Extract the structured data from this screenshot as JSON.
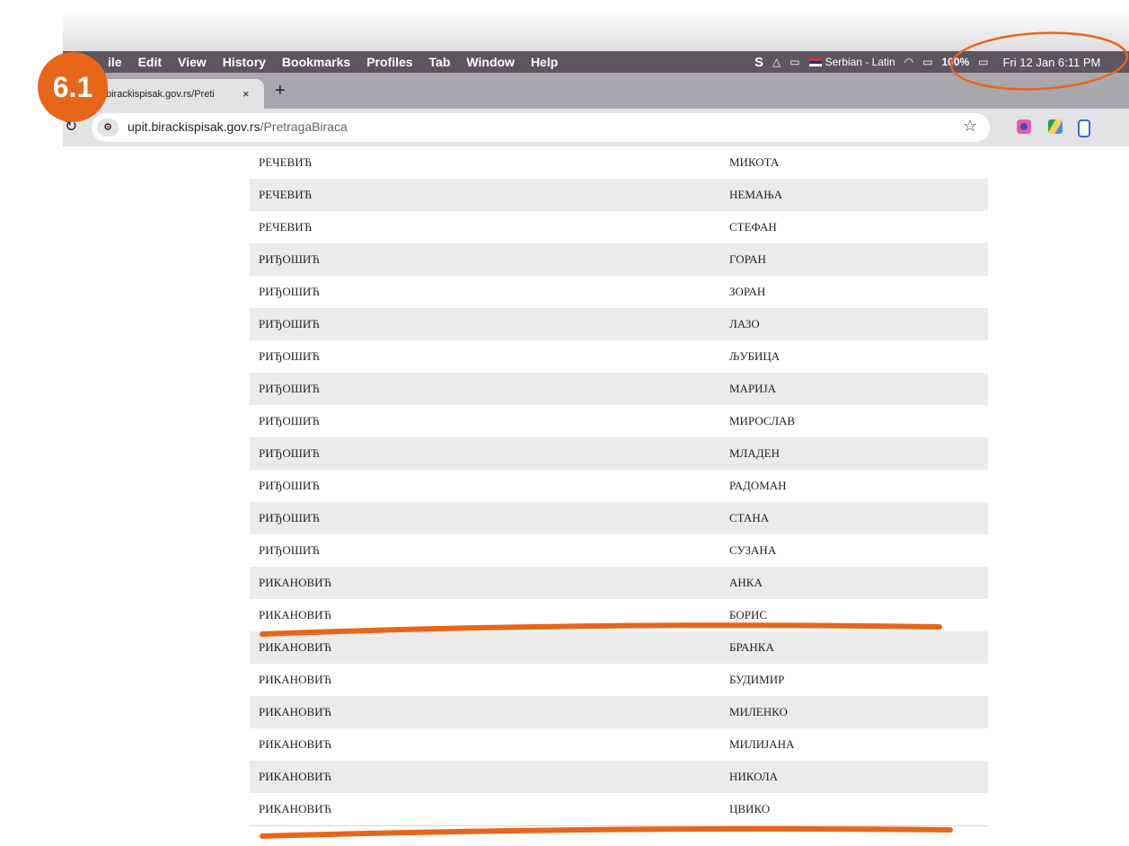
{
  "badge": "6.1",
  "menubar": {
    "items": [
      "ile",
      "Edit",
      "View",
      "History",
      "Bookmarks",
      "Profiles",
      "Tab",
      "Window",
      "Help"
    ],
    "input_source": "Serbian - Latin",
    "battery": "100%",
    "clock": "Fri 12 Jan  6:11 PM"
  },
  "tab": {
    "title": "birackispisak.gov.rs/Preti",
    "close": "×",
    "new_tab": "+"
  },
  "address": {
    "host": "upit.birackispisak.gov.rs",
    "path": "/PretragaBiraca"
  },
  "rows": [
    [
      "РЕЧЕВИЋ",
      "МИКОТА"
    ],
    [
      "РЕЧЕВИЋ",
      "НЕМАЊА"
    ],
    [
      "РЕЧЕВИЋ",
      "СТЕФАН"
    ],
    [
      "РИЂОШИЋ",
      "ГОРАН"
    ],
    [
      "РИЂОШИЋ",
      "ЗОРАН"
    ],
    [
      "РИЂОШИЋ",
      "ЛАЗО"
    ],
    [
      "РИЂОШИЋ",
      "ЉУБИЦА"
    ],
    [
      "РИЂОШИЋ",
      "МАРИЈА"
    ],
    [
      "РИЂОШИЋ",
      "МИРОСЛАВ"
    ],
    [
      "РИЂОШИЋ",
      "МЛАДЕН"
    ],
    [
      "РИЂОШИЋ",
      "РАДОМАН"
    ],
    [
      "РИЂОШИЋ",
      "СТАНА"
    ],
    [
      "РИЂОШИЋ",
      "СУЗАНА"
    ],
    [
      "РИКАНОВИЋ",
      "АНКА"
    ],
    [
      "РИКАНОВИЋ",
      "БОРИС"
    ],
    [
      "РИКАНОВИЋ",
      "БРАНКА"
    ],
    [
      "РИКАНОВИЋ",
      "БУДИМИР"
    ],
    [
      "РИКАНОВИЋ",
      "МИЛЕНКО"
    ],
    [
      "РИКАНОВИЋ",
      "МИЛИЈАНА"
    ],
    [
      "РИКАНОВИЋ",
      "НИКОЛА"
    ],
    [
      "РИКАНОВИЋ",
      "ЦВИКО"
    ]
  ],
  "colors": {
    "annotation": "#e8661a",
    "menubar": "#5d5560"
  }
}
